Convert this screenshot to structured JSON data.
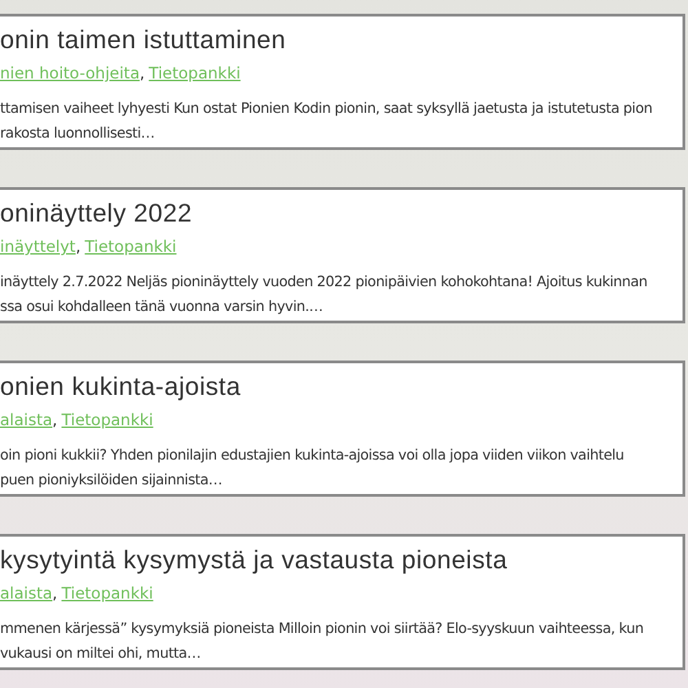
{
  "category_separator": ",",
  "posts": [
    {
      "title": "onin taimen istuttaminen",
      "categories": [
        "nien hoito-ohjeita",
        "Tietopankki"
      ],
      "excerpt_lines": [
        "ttamisen vaiheet lyhyesti Kun ostat Pionien Kodin pionin, saat syksyllä jaetusta ja istutetusta pion",
        "rakosta luonnollisesti…"
      ]
    },
    {
      "title": "oninäyttely 2022",
      "categories": [
        "inäyttelyt",
        "Tietopankki"
      ],
      "excerpt_lines": [
        "inäyttely 2.7.2022 Neljäs pioninäyttely vuoden 2022 pionipäivien kohokohtana! Ajoitus kukinnan",
        "ssa osui kohdalleen tänä vuonna varsin hyvin.…"
      ]
    },
    {
      "title": "onien kukinta-ajoista",
      "categories": [
        "alaista",
        "Tietopankki"
      ],
      "excerpt_lines": [
        "oin pioni kukkii? Yhden pionilajin edustajien kukinta-ajoissa voi olla jopa viiden viikon vaihtelu",
        "puen pioniyksilöiden sijainnista…"
      ]
    },
    {
      "title": "kysytyintä kysymystä ja vastausta pioneista",
      "categories": [
        "alaista",
        "Tietopankki"
      ],
      "excerpt_lines": [
        "mmenen kärjessä” kysymyksiä pioneista Milloin pionin voi siirtää? Elo-syyskuun vaihteessa, kun",
        "vukausi on miltei ohi, mutta…"
      ]
    }
  ]
}
